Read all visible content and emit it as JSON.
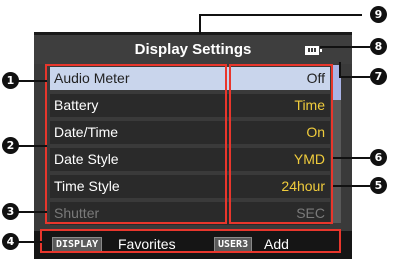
{
  "title": "Display Settings",
  "menu": {
    "items": [
      {
        "label": "Audio Meter",
        "value": "Off",
        "state": "selected"
      },
      {
        "label": "Battery",
        "value": "Time",
        "state": "normal"
      },
      {
        "label": "Date/Time",
        "value": "On",
        "state": "normal"
      },
      {
        "label": "Date Style",
        "value": "YMD",
        "state": "normal"
      },
      {
        "label": "Time Style",
        "value": "24hour",
        "state": "normal"
      },
      {
        "label": "Shutter",
        "value": "SEC",
        "state": "disabled"
      }
    ],
    "scroll_position": 0.0,
    "scroll_visible_fraction": 0.22
  },
  "footer": {
    "display_button": "DISPLAY",
    "display_action": "Favorites",
    "user_button": "USER3",
    "user_action": "Add"
  },
  "status": {
    "battery_icon": "battery-icon"
  },
  "callouts": [
    "1",
    "2",
    "3",
    "4",
    "5",
    "6",
    "7",
    "8",
    "9"
  ],
  "colors": {
    "value_text": "#f0cc3c",
    "selected_row": "#c9d5ec",
    "callout_frame": "#e8362c",
    "scroll_thumb": "#aab4e6"
  }
}
